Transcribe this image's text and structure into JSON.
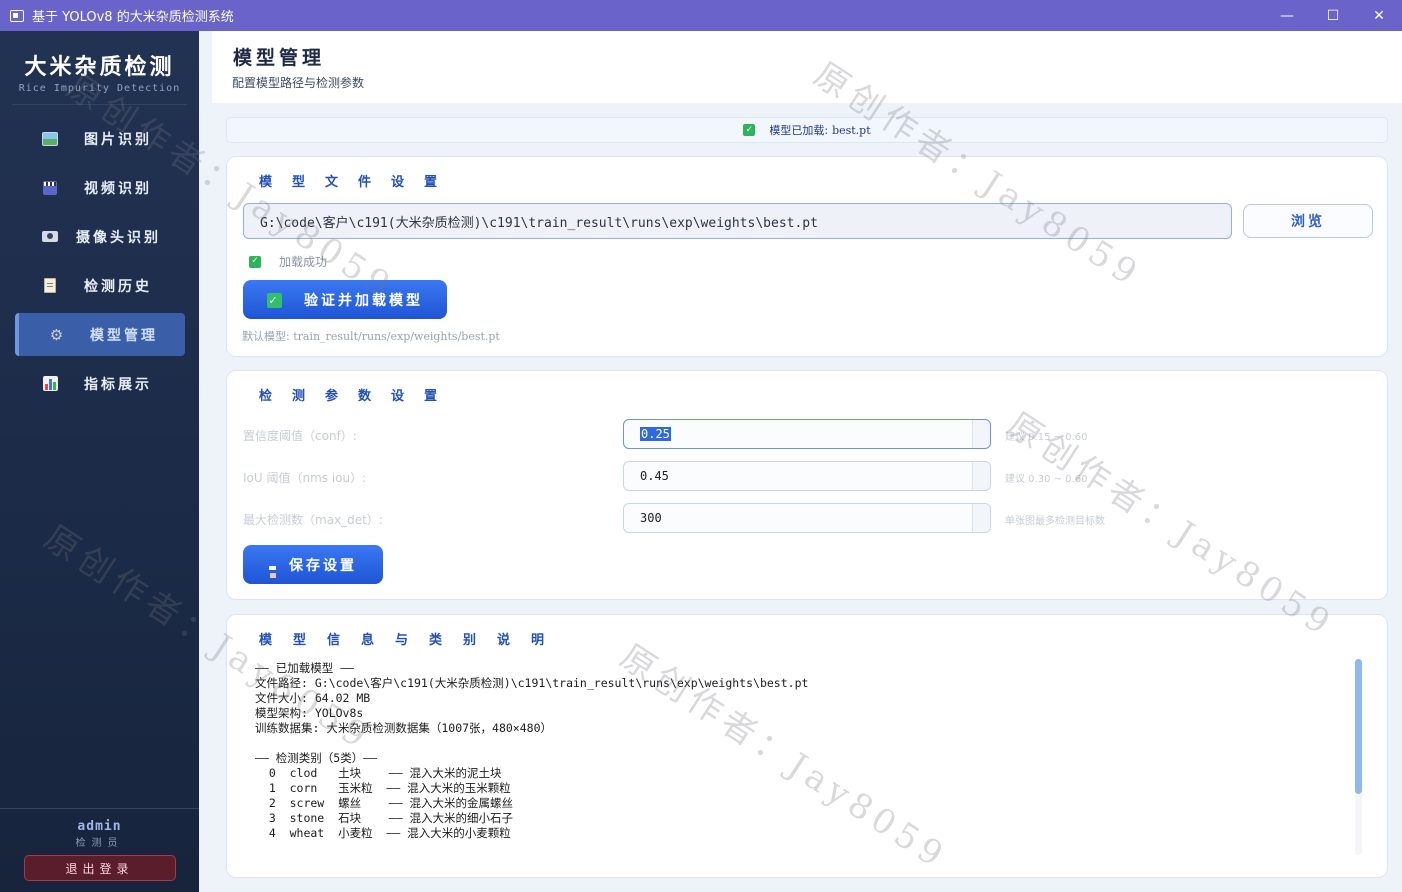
{
  "window": {
    "title": "基于 YOLOv8 的大米杂质检测系统",
    "minimize": "—",
    "maximize": "☐",
    "close": "✕"
  },
  "sidebar": {
    "brand_title": "大米杂质检测",
    "brand_subtitle": "Rice Impurity Detection",
    "items": [
      {
        "label": "图片识别",
        "icon": "image-icon"
      },
      {
        "label": "视频识别",
        "icon": "clapper-icon"
      },
      {
        "label": "摄像头识别",
        "icon": "camera-icon"
      },
      {
        "label": "检测历史",
        "icon": "clipboard-icon"
      },
      {
        "label": "模型管理",
        "icon": "gear-icon",
        "active": true
      },
      {
        "label": "指标展示",
        "icon": "bar-chart-icon"
      }
    ],
    "user": "admin",
    "role": "检测员",
    "logout": "退出登录"
  },
  "header": {
    "title": "模型管理",
    "subtitle": "配置模型路径与检测参数"
  },
  "status": {
    "text": "模型已加载:",
    "file": "best.pt"
  },
  "model_file": {
    "title": "模型文件设置",
    "path": "G:\\code\\客户\\c191(大米杂质检测)\\c191\\train_result\\runs\\exp\\weights\\best.pt",
    "browse": "浏览",
    "load_state": "加载成功",
    "verify_button": "验证并加载模型",
    "default_label": "默认模型:",
    "default_path": "train_result/runs/exp/weights/best.pt"
  },
  "params": {
    "title": "检测参数设置",
    "conf": {
      "label": "置信度阈值（conf）:",
      "value": "0.25",
      "hint": "建议 0.15 ~ 0.60"
    },
    "iou": {
      "label": "IoU 阈值（nms iou）:",
      "value": "0.45",
      "hint": "建议 0.30 ~ 0.60"
    },
    "max_det": {
      "label": "最大检测数（max_det）:",
      "value": "300",
      "hint": "单张图最多检测目标数"
    },
    "save_button": "保存设置"
  },
  "info": {
    "title": "模型信息与类别说明",
    "text": "—— 已加载模型 ——\n文件路径: G:\\code\\客户\\c191(大米杂质检测)\\c191\\train_result\\runs\\exp\\weights\\best.pt\n文件大小: 64.02 MB\n模型架构: YOLOv8s\n训练数据集: 大米杂质检测数据集（1007张，480×480）\n\n—— 检测类别（5类）——\n  0  clod   土块    —— 混入大米的泥土块\n  1  corn   玉米粒  —— 混入大米的玉米颗粒\n  2  screw  螺丝    —— 混入大米的金属螺丝\n  3  stone  石块    —— 混入大米的细小石子\n  4  wheat  小麦粒  —— 混入大米的小麦颗粒"
  },
  "watermark": "原创作者：Jay8059",
  "colors": {
    "titlebar": "#6a63c9",
    "sidebar": "#1f2e4c",
    "accent": "#2350b8",
    "primary_button": "#2a62e2",
    "success": "#2fb35a",
    "logout": "#5a1e2a"
  }
}
